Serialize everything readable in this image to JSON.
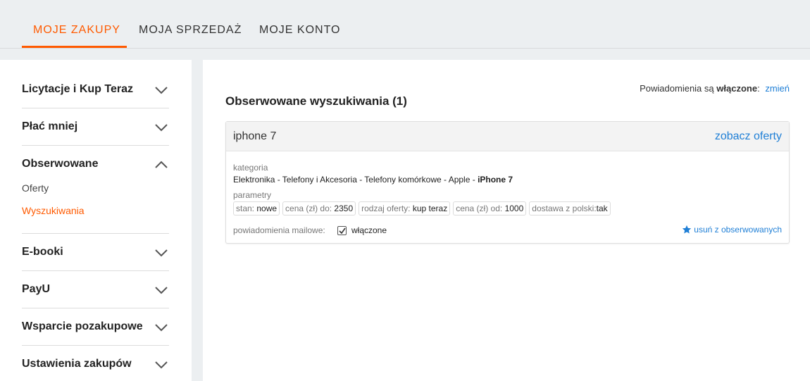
{
  "topnav": {
    "tabs": [
      {
        "label": "MOJE ZAKUPY",
        "active": true
      },
      {
        "label": "MOJA SPRZEDAŻ",
        "active": false
      },
      {
        "label": "MOJE KONTO",
        "active": false
      }
    ]
  },
  "sidebar": {
    "sections": [
      {
        "label": "Licytacje i Kup Teraz",
        "expanded": false
      },
      {
        "label": "Płać mniej",
        "expanded": false
      },
      {
        "label": "Obserwowane",
        "expanded": true,
        "items": [
          {
            "label": "Oferty",
            "active": false
          },
          {
            "label": "Wyszukiwania",
            "active": true
          }
        ]
      },
      {
        "label": "E-booki",
        "expanded": false
      },
      {
        "label": "PayU",
        "expanded": false
      },
      {
        "label": "Wsparcie pozakupowe",
        "expanded": false
      },
      {
        "label": "Ustawienia zakupów",
        "expanded": false
      }
    ]
  },
  "main": {
    "notifications": {
      "prefix": "Powiadomienia są",
      "status": "włączone",
      "suffix": ":",
      "change_link": "zmień"
    },
    "title": "Obserwowane wyszukiwania (1)",
    "search": {
      "query": "iphone 7",
      "see_offers": "zobacz oferty",
      "category_label": "kategoria",
      "category_path": "Elektronika - Telefony i Akcesoria - Telefony komórkowe - Apple - ",
      "category_last": "iPhone 7",
      "params_label": "parametry",
      "params": [
        {
          "name": "stan:",
          "value": "nowe"
        },
        {
          "name": "cena (zł) do:",
          "value": "2350"
        },
        {
          "name": "rodzaj oferty:",
          "value": "kup teraz"
        },
        {
          "name": "cena (zł) od:",
          "value": "1000"
        },
        {
          "name": "dostawa z polski:",
          "value": "tak"
        }
      ],
      "mail_label": "powiadomienia mailowe:",
      "mail_enabled": true,
      "mail_value": "włączone",
      "remove_label": "usuń z obserwowanych"
    }
  },
  "colors": {
    "accent": "#ff5a00",
    "link": "#1f7fd6"
  }
}
